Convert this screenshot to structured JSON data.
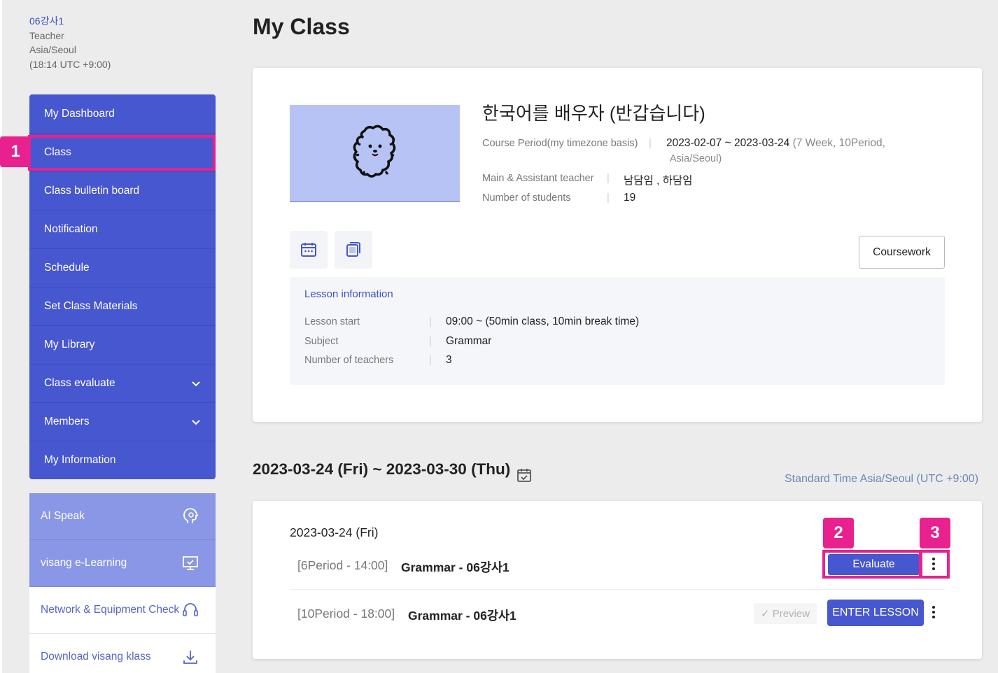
{
  "profile": {
    "name": "06강사1",
    "role": "Teacher",
    "timezone": "Asia/Seoul",
    "time": "(18:14 UTC +9:00)"
  },
  "sidebar": {
    "items": [
      {
        "label": "My Dashboard"
      },
      {
        "label": "Class"
      },
      {
        "label": "Class bulletin board"
      },
      {
        "label": "Notification"
      },
      {
        "label": "Schedule"
      },
      {
        "label": "Set Class Materials"
      },
      {
        "label": "My Library"
      },
      {
        "label": "Class evaluate",
        "expandable": true
      },
      {
        "label": "Members",
        "expandable": true
      },
      {
        "label": "My Information"
      }
    ],
    "tools": [
      {
        "label": "AI Speak",
        "icon": "ai-speak-icon"
      },
      {
        "label": "visang e-Learning",
        "icon": "monitor-icon"
      },
      {
        "label": "Network & Equipment Check",
        "icon": "headset-icon"
      },
      {
        "label": "Download visang klass",
        "icon": "download-icon"
      }
    ]
  },
  "annotations": {
    "b1": "1",
    "b2": "2",
    "b3": "3"
  },
  "page_title": "My Class",
  "course": {
    "title": "한국어를 배우자 (반갑습니다)",
    "period_label": "Course Period(my timezone basis)",
    "period_value": "2023-02-07 ~ 2023-03-24",
    "period_extra": "(7 Week,  10Period,",
    "period_extra2": "Asia/Seoul)",
    "teacher_label": "Main & Assistant teacher",
    "teacher_value": "남담임 , 하담임",
    "students_label": "Number of students",
    "students_value": "19",
    "coursework_label": "Coursework"
  },
  "lesson_info": {
    "heading": "Lesson information",
    "rows": [
      {
        "label": "Lesson start",
        "value": "09:00 ~ (50min class, 10min break time)"
      },
      {
        "label": "Subject",
        "value": "Grammar"
      },
      {
        "label": "Number of teachers",
        "value": "3"
      }
    ]
  },
  "week": {
    "range": "2023-03-24 (Fri) ~ 2023-03-30 (Thu)",
    "standard_time": "Standard Time Asia/Seoul (UTC +9:00)"
  },
  "day": {
    "date": "2023-03-24 (Fri)",
    "lessons": [
      {
        "period": "[6Period - 14:00]",
        "name": "Grammar - 06강사1",
        "action": "Evaluate"
      },
      {
        "period": "[10Period - 18:00]",
        "name": "Grammar - 06강사1",
        "preview": "✓ Preview",
        "action": "ENTER LESSON"
      }
    ]
  },
  "colors": {
    "accent": "#4657cf",
    "highlight": "#e8218e",
    "link": "#3a52c6"
  }
}
